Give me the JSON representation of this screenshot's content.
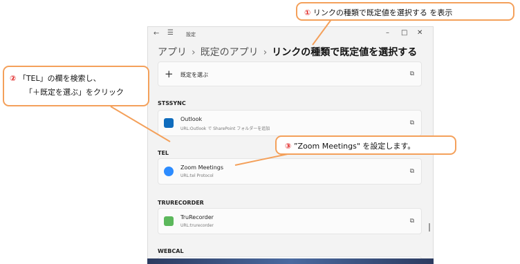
{
  "window": {
    "title": "設定",
    "back_icon": "back-arrow-icon",
    "menu_icon": "hamburger-icon"
  },
  "breadcrumb": {
    "items": [
      "アプリ",
      "既定のアプリ"
    ],
    "separator": "›",
    "current": "リンクの種類で既定値を選択する"
  },
  "cards": {
    "choose_default": {
      "label": "既定を選ぶ"
    },
    "outlook": {
      "name": "Outlook",
      "url": "URL:Outlook で SharePoint フォルダーを追加"
    },
    "zoom": {
      "name": "Zoom Meetings",
      "url": "URL:tel Protocol"
    },
    "trurecorder": {
      "name": "TruRecorder",
      "url": "URL:trurecorder"
    }
  },
  "sections": {
    "stssync": "STSSYNC",
    "tel": "TEL",
    "trurecorder": "TRURECORDER",
    "webcal": "WEBCAL"
  },
  "callouts": {
    "c1": {
      "num": "①",
      "text": "リンクの種類で既定値を選択する を表示"
    },
    "c2": {
      "num": "②",
      "line1": "「TEL」の欄を検索し、",
      "line2": "「＋既定を選ぶ」をクリック"
    },
    "c3": {
      "num": "③",
      "text": "”Zoom Meetings\" を設定します。"
    }
  },
  "colors": {
    "callout_border": "#f4a05a",
    "number_red": "#e02020",
    "zoom_blue": "#2d8cff",
    "outlook_blue": "#0f6cbd",
    "trurecorder_green": "#5cb85c"
  }
}
